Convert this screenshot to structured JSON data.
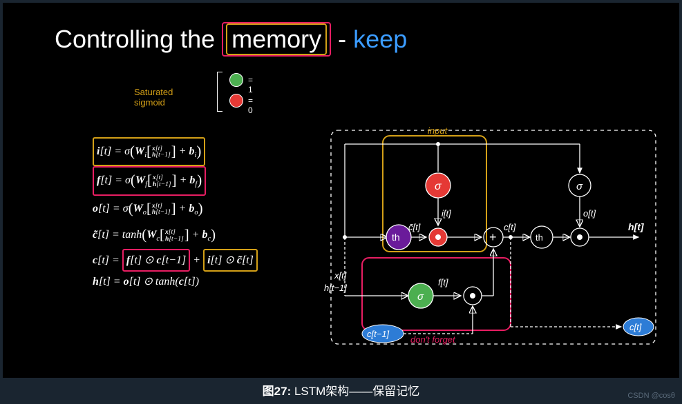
{
  "title": {
    "prefix": "Controlling the ",
    "memory": "memory",
    "dash": " - ",
    "keep": "keep"
  },
  "legend": {
    "label": "Saturated sigmoid",
    "eq1": "= 1",
    "eq0": "= 0"
  },
  "equations": {
    "i": "i[t] = σ(Wᵢ[x[t]; h[t−1]] + bᵢ)",
    "f": "f[t] = σ(W_f[x[t]; h[t−1]] + b_f)",
    "o": "o[t] = σ(Wₒ[x[t]; h[t−1]] + bₒ)",
    "ctilde": "c̃[t] = tanh(W_c[x[t]; h[t−1]] + b_c)",
    "c_prefix": "c[t] = ",
    "c_term1": "f[t] ⊙ c[t−1]",
    "c_plus": " + ",
    "c_term2": "i[t] ⊙ c̃[t]",
    "h": "h[t] = o[t] ⊙ tanh(c[t])"
  },
  "diagram": {
    "input_label": "input",
    "dont_forget_label": "don't forget",
    "x_t": "x[t]",
    "h_tm1": "h[t−1]",
    "c_tm1": "c[t−1]",
    "c_tilde_t": "c̃[t]",
    "i_t": "i[t]",
    "f_t": "f[t]",
    "c_t": "c[t]",
    "o_t": "o[t]",
    "h_t": "h[t]",
    "sigma": "σ",
    "th": "th",
    "plus": "+"
  },
  "caption": {
    "bold": "图27: ",
    "text": "LSTM架构——保留记忆"
  },
  "watermark": "CSDN @cosθ"
}
